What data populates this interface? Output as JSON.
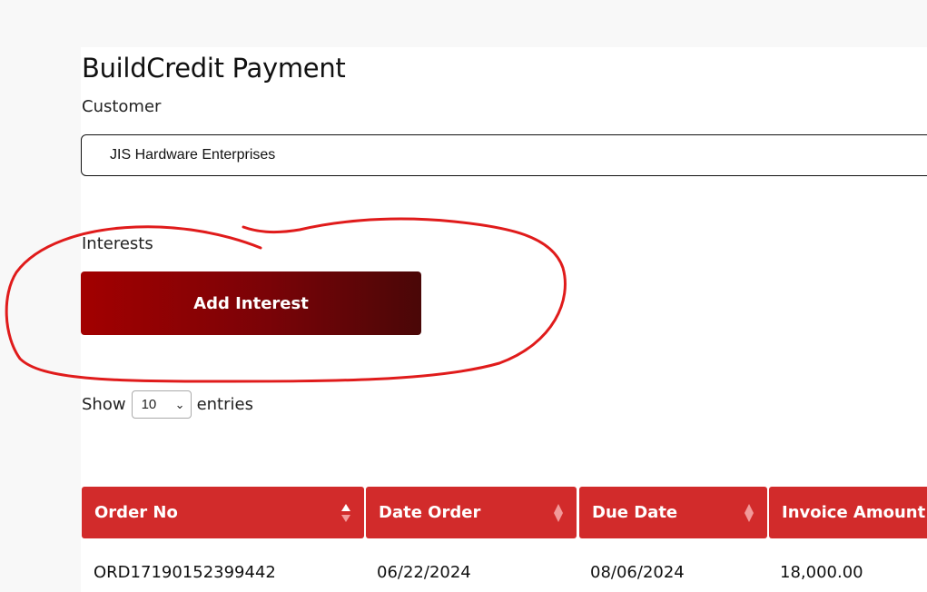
{
  "page": {
    "title": "BuildCredit Payment",
    "customer_label": "Customer",
    "customer_value": "JIS Hardware Enterprises",
    "interests_label": "Interests",
    "add_interest_label": "Add Interest",
    "show_label": "Show",
    "entries_value": "10",
    "entries_label": "entries"
  },
  "table": {
    "columns": [
      {
        "label": "Order No",
        "sort": "asc"
      },
      {
        "label": "Date Order",
        "sort": "none"
      },
      {
        "label": "Due Date",
        "sort": "none"
      },
      {
        "label": "Invoice Amount",
        "sort": "none"
      }
    ],
    "rows": [
      [
        "ORD17190152399442",
        "06/22/2024",
        "08/06/2024",
        "18,000.00"
      ]
    ]
  },
  "colors": {
    "header_bg": "#d22b2b",
    "button_start": "#a20000",
    "button_end": "#4a0707",
    "annotation": "#e02020"
  }
}
